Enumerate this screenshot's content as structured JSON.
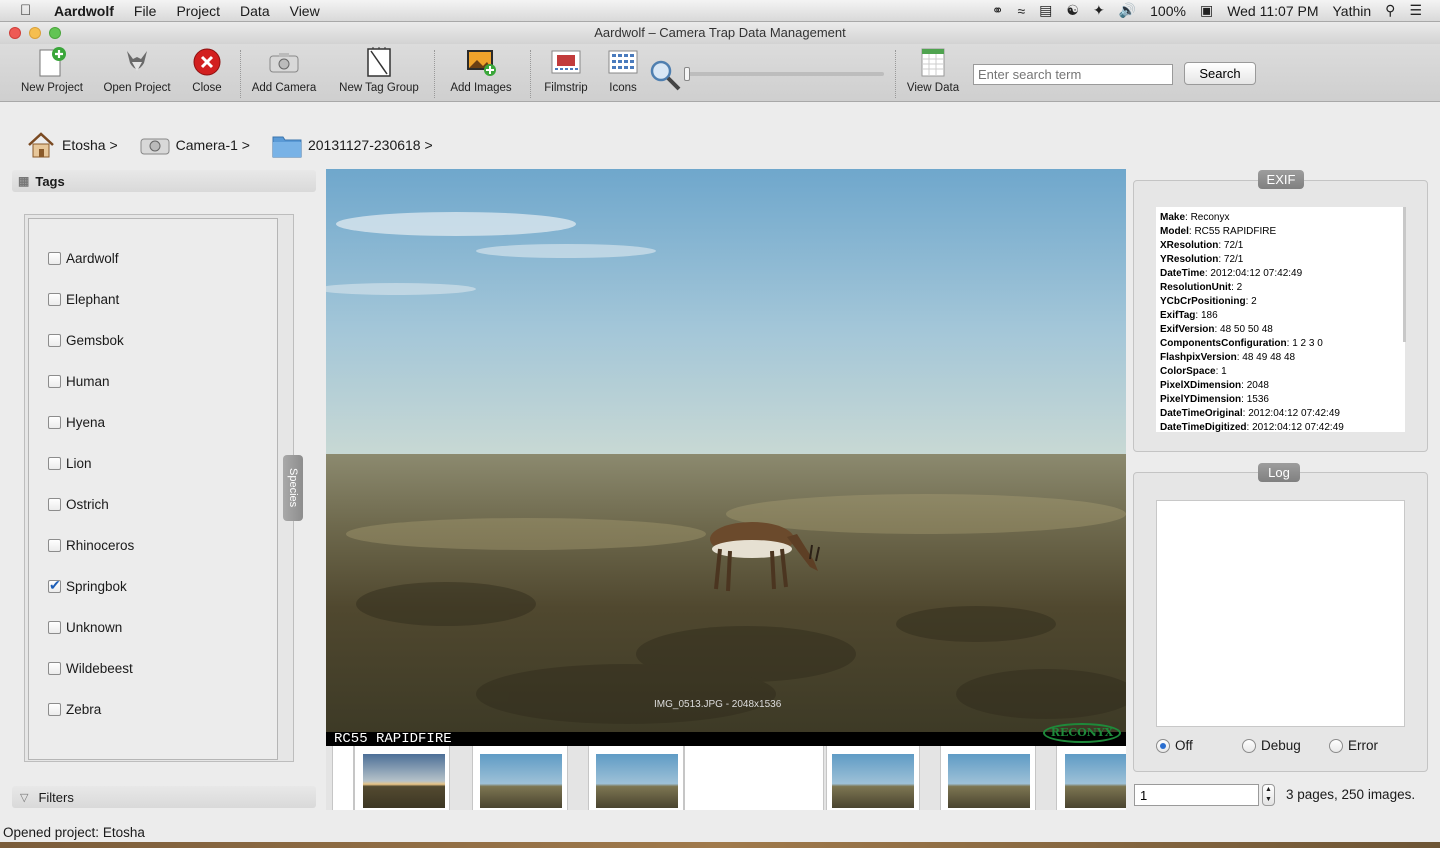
{
  "menubar": {
    "app_name": "Aardwolf",
    "menus": [
      "File",
      "Project",
      "Data",
      "View"
    ],
    "battery": "100%",
    "clock": "Wed 11:07 PM",
    "user": "Yathin"
  },
  "window": {
    "title": "Aardwolf – Camera Trap Data Management"
  },
  "toolbar": {
    "new_project": "New Project",
    "open_project": "Open Project",
    "close": "Close",
    "add_camera": "Add Camera",
    "new_tag_group": "New Tag Group",
    "add_images": "Add Images",
    "filmstrip": "Filmstrip",
    "icons": "Icons",
    "view_data": "View Data",
    "search_placeholder": "Enter search term",
    "search_label": "Search"
  },
  "breadcrumb": {
    "project": "Etosha >",
    "camera": "Camera-1 >",
    "folder": "20131127-230618 >"
  },
  "tags": {
    "header": "Tags",
    "group_tab": "Species",
    "items": [
      {
        "label": "Aardwolf",
        "checked": false
      },
      {
        "label": "Elephant",
        "checked": false
      },
      {
        "label": "Gemsbok",
        "checked": false
      },
      {
        "label": "Human",
        "checked": false
      },
      {
        "label": "Hyena",
        "checked": false
      },
      {
        "label": "Lion",
        "checked": false
      },
      {
        "label": "Ostrich",
        "checked": false
      },
      {
        "label": "Rhinoceros",
        "checked": false
      },
      {
        "label": "Springbok",
        "checked": true
      },
      {
        "label": "Unknown",
        "checked": false
      },
      {
        "label": "Wildebeest",
        "checked": false
      },
      {
        "label": "Zebra",
        "checked": false
      }
    ],
    "filters_header": "Filters"
  },
  "viewer": {
    "caption": "IMG_0513.JPG - 2048x1536",
    "camera_model_overlay": "RC55 RAPIDFIRE",
    "logo_text": "RECONYX"
  },
  "exif": {
    "title": "EXIF",
    "rows": [
      {
        "key": "Make",
        "value": "Reconyx"
      },
      {
        "key": "Model",
        "value": "RC55 RAPIDFIRE"
      },
      {
        "key": "XResolution",
        "value": "72/1"
      },
      {
        "key": "YResolution",
        "value": "72/1"
      },
      {
        "key": "DateTime",
        "value": "2012:04:12 07:42:49"
      },
      {
        "key": "ResolutionUnit",
        "value": "2"
      },
      {
        "key": "YCbCrPositioning",
        "value": "2"
      },
      {
        "key": "ExifTag",
        "value": "186"
      },
      {
        "key": "ExifVersion",
        "value": "48 50 50 48"
      },
      {
        "key": "ComponentsConfiguration",
        "value": "1 2 3 0"
      },
      {
        "key": "FlashpixVersion",
        "value": "48 49 48 48"
      },
      {
        "key": "ColorSpace",
        "value": "1"
      },
      {
        "key": "PixelXDimension",
        "value": "2048"
      },
      {
        "key": "PixelYDimension",
        "value": "1536"
      },
      {
        "key": "DateTimeOriginal",
        "value": "2012:04:12 07:42:49"
      },
      {
        "key": "DateTimeDigitized",
        "value": "2012:04:12 07:42:49"
      }
    ]
  },
  "log": {
    "title": "Log",
    "levels": [
      "Off",
      "Debug",
      "Error"
    ],
    "selected": "Off"
  },
  "paging": {
    "page_value": "1",
    "summary": "3 pages, 250 images."
  },
  "status": {
    "message": "Opened project: Etosha"
  }
}
